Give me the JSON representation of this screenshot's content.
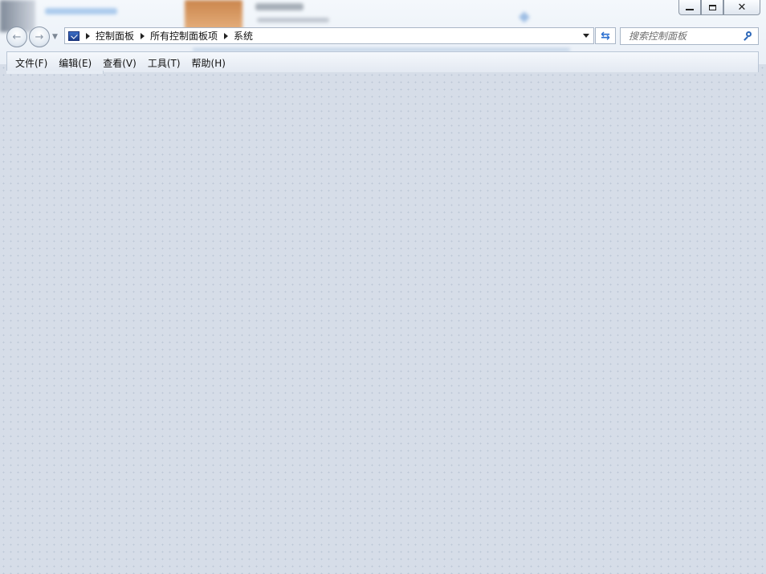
{
  "window": {
    "controls": {
      "minimize": "",
      "maximize": "",
      "close": ""
    }
  },
  "address": {
    "crumbs": [
      "控制面板",
      "所有控制面板项",
      "系统"
    ]
  },
  "search": {
    "placeholder": "搜索控制面板"
  },
  "menu": {
    "items": [
      "文件(F)",
      "编辑(E)",
      "查看(V)",
      "工具(T)",
      "帮助(H)"
    ]
  },
  "colors": {
    "accent": "#2e68b8",
    "content_bg": "#d6dde8"
  },
  "icons": {
    "back": "back-arrow-icon",
    "forward": "forward-arrow-icon",
    "refresh": "refresh-icon",
    "search": "search-icon",
    "address": "control-panel-icon"
  }
}
